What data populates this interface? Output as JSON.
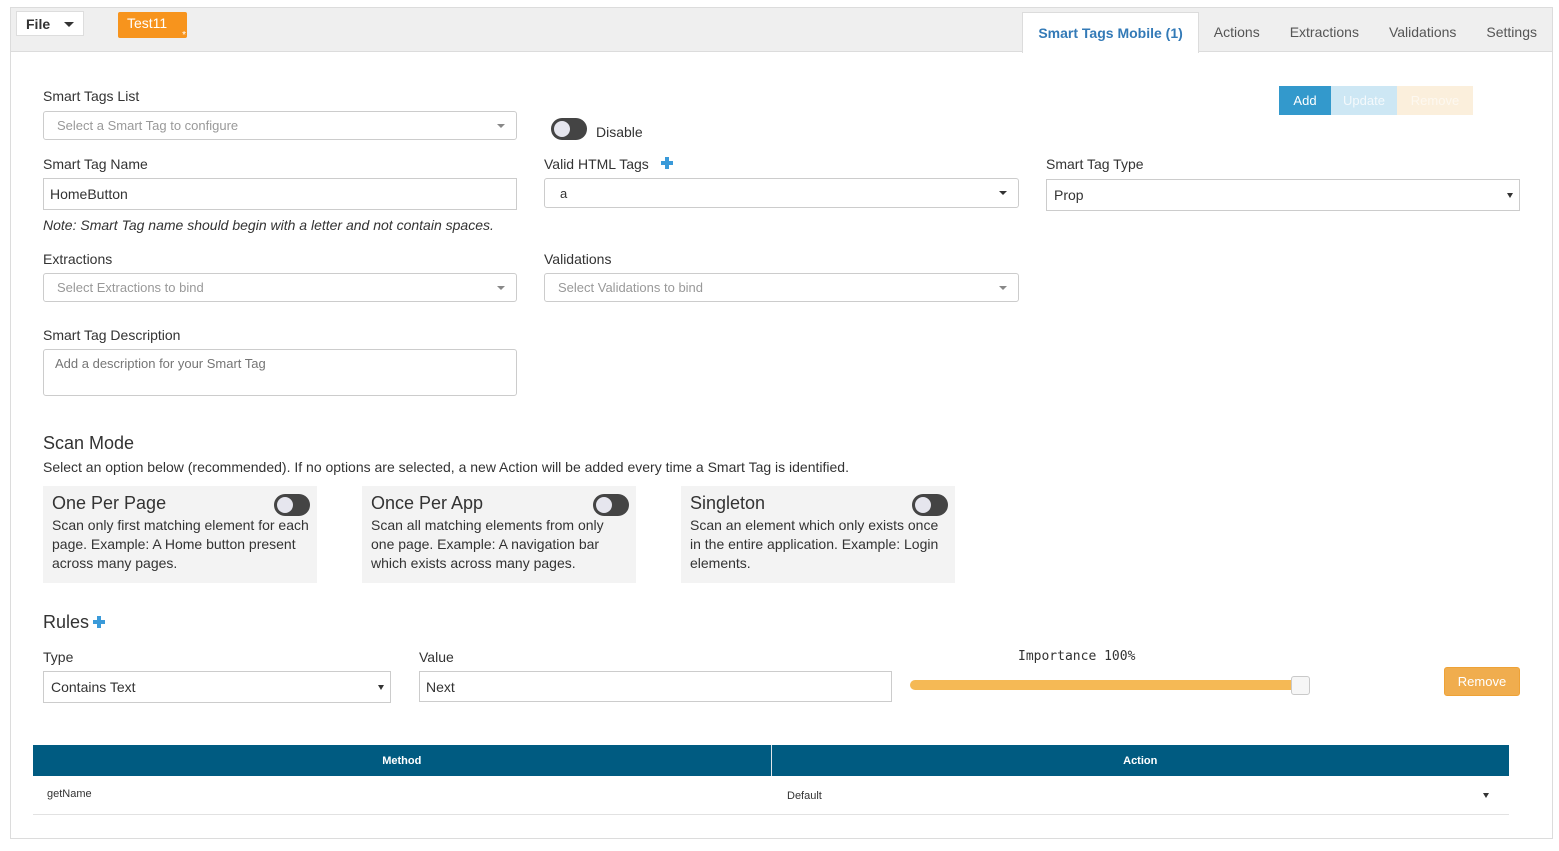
{
  "topbar": {
    "file_label": "File",
    "project_badge": "Test11",
    "project_badge_marker": "*",
    "tabs": [
      {
        "label": "Smart Tags Mobile (1)",
        "active": true
      },
      {
        "label": "Actions"
      },
      {
        "label": "Extractions"
      },
      {
        "label": "Validations"
      },
      {
        "label": "Settings"
      }
    ]
  },
  "form": {
    "smart_tags_list_label": "Smart Tags List",
    "smart_tags_list_placeholder": "Select a Smart Tag to configure",
    "disable_label": "Disable",
    "actions": {
      "add": "Add",
      "update": "Update",
      "remove": "Remove"
    },
    "smart_tag_name_label": "Smart Tag Name",
    "smart_tag_name_value": "HomeButton",
    "name_note": "Note: Smart Tag name should begin with a letter and not contain spaces.",
    "valid_html_tags_label": "Valid HTML Tags",
    "valid_html_tags_value": "a",
    "smart_tag_type_label": "Smart Tag Type",
    "smart_tag_type_value": "Prop",
    "extractions_label": "Extractions",
    "extractions_placeholder": "Select Extractions to bind",
    "validations_label": "Validations",
    "validations_placeholder": "Select Validations to bind",
    "description_label": "Smart Tag Description",
    "description_placeholder": "Add a description for your Smart Tag"
  },
  "scan_mode": {
    "title": "Scan Mode",
    "subtitle": "Select an option below (recommended). If no options are selected, a new Action will be added every time a Smart Tag is identified.",
    "options": [
      {
        "title": "One Per Page",
        "desc": "Scan only first matching element for each page. Example: A Home button present across many pages."
      },
      {
        "title": "Once Per App",
        "desc": "Scan all matching elements from only one page. Example: A navigation bar which exists across many pages."
      },
      {
        "title": "Singleton",
        "desc": "Scan an element which only exists once in the entire application. Example: Login elements."
      }
    ]
  },
  "rules": {
    "title": "Rules",
    "type_label": "Type",
    "type_value": "Contains Text",
    "value_label": "Value",
    "value_value": "Next",
    "importance_label": "Importance 100%",
    "importance_value": 100,
    "remove_label": "Remove"
  },
  "table": {
    "headers": [
      "Method",
      "Action"
    ],
    "rows": [
      {
        "method": "getName",
        "action": "Default"
      }
    ]
  },
  "colors": {
    "accent_blue": "#3399cc",
    "tab_active_text": "#337ab7",
    "badge_orange": "#f7941d",
    "table_header": "#005b81",
    "slider": "#f5b955",
    "remove_button": "#f0ad4e"
  }
}
